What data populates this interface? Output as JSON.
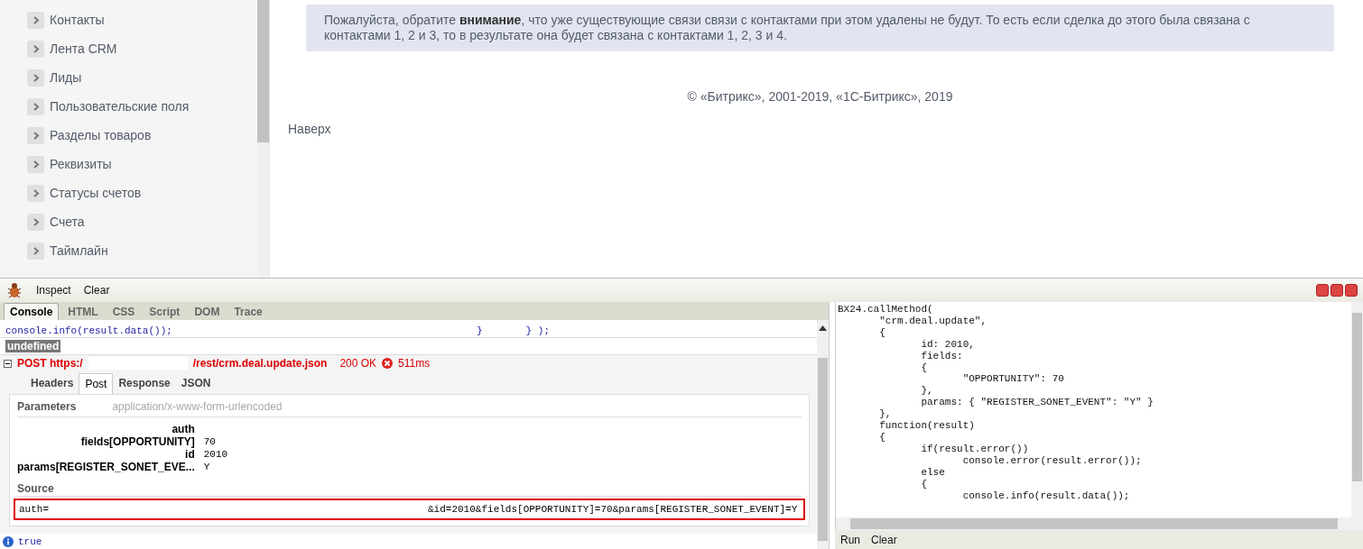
{
  "sidebar": {
    "items": [
      {
        "label": "Контакты"
      },
      {
        "label": "Лента CRM"
      },
      {
        "label": "Лиды"
      },
      {
        "label": "Пользовательские поля"
      },
      {
        "label": "Разделы товаров"
      },
      {
        "label": "Реквизиты"
      },
      {
        "label": "Статусы счетов"
      },
      {
        "label": "Счета"
      },
      {
        "label": "Таймлайн"
      }
    ]
  },
  "notice": "Пожалуйста, обратите **внимание**, что уже существующие связи связи с контактами при этом удалены не будут. То есть если сделка до этого была связана с контактами 1, 2 и 3, то в результате она будет связана с контактами 1, 2, 3 и 4.",
  "footer": {
    "copyright": "© «Битрикс», 2001-2019, «1С-Битрикс», 2019",
    "back_to_top": "Наверх"
  },
  "firebug": {
    "toolbar": [
      "Inspect",
      "Clear"
    ],
    "tabs": [
      {
        "label": "Console",
        "selected": true
      },
      {
        "label": "HTML",
        "selected": false
      },
      {
        "label": "CSS",
        "selected": false
      },
      {
        "label": "Script",
        "selected": false
      },
      {
        "label": "DOM",
        "selected": false
      },
      {
        "label": "Trace",
        "selected": false
      }
    ],
    "console": {
      "code_line": "console.info(result.data());",
      "code_tail": [
        "}",
        "} );"
      ],
      "result": "undefined",
      "request": {
        "method_url": "POST https:/",
        "path": "/rest/crm.deal.update.json",
        "status": "200 OK",
        "time": "511ms",
        "expanded": true,
        "tabs": [
          {
            "label": "Headers",
            "selected": false
          },
          {
            "label": "Post",
            "selected": true
          },
          {
            "label": "Response",
            "selected": false
          },
          {
            "label": "JSON",
            "selected": false
          }
        ],
        "parameters_header": "Parameters",
        "content_type": "application/x-www-form-urlencoded",
        "params": [
          {
            "name": "auth"
          },
          {
            "name": "fields[OPPORTUNITY]",
            "value": "70"
          },
          {
            "name": "id",
            "value": "2010"
          },
          {
            "name": "params[REGISTER_SONET_EVE...",
            "value": "Y"
          }
        ],
        "source_header": "Source",
        "source_start": "auth=",
        "source_end": "&id=2010&fields[OPPORTUNITY]=70&params[REGISTER_SONET_EVENT]=Y"
      },
      "last_result": "true"
    },
    "editor": {
      "code": "BX24.callMethod(\n\t\"crm.deal.update\",\n\t{\n\t\tid: 2010,\n\t\tfields:\n\t\t{\n\t\t\t\"OPPORTUNITY\": 70\n\t\t},\n\t\tparams: { \"REGISTER_SONET_EVENT\": \"Y\" }\n\t},\n\tfunction(result)\n\t{\n\t\tif(result.error())\n\t\t\tconsole.error(result.error());\n\t\telse\n\t\t{\n\t\t\tconsole.info(result.data());",
      "buttons": [
        "Run",
        "Clear"
      ]
    }
  }
}
